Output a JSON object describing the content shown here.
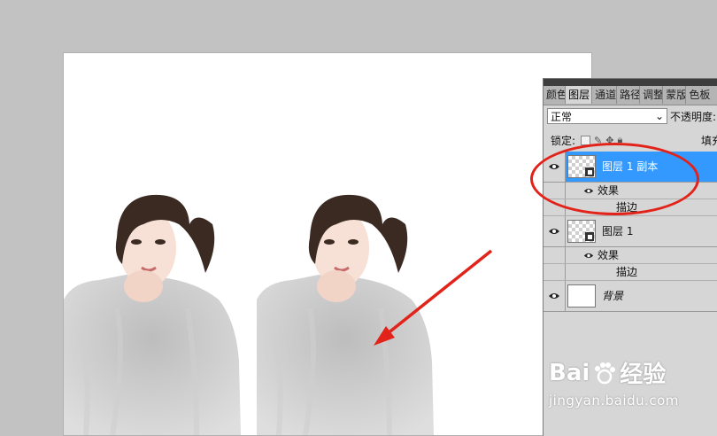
{
  "panel": {
    "tabs": [
      {
        "label": "颜色",
        "active": false
      },
      {
        "label": "图层",
        "active": true
      },
      {
        "label": "通道",
        "active": false
      },
      {
        "label": "路径",
        "active": false
      },
      {
        "label": "调整",
        "active": false
      },
      {
        "label": "蒙版",
        "active": false
      },
      {
        "label": "色板",
        "active": false
      }
    ],
    "blend_mode": "正常",
    "opacity_label": "不透明度:",
    "lock_label": "锁定:",
    "fill_label": "填充:",
    "layers": [
      {
        "name": "图层 1 副本",
        "selected": true,
        "effects_label": "效果",
        "stroke_label": "描边",
        "thumb": "checker-smart"
      },
      {
        "name": "图层 1",
        "selected": false,
        "effects_label": "效果",
        "stroke_label": "描边",
        "thumb": "checker-smart"
      },
      {
        "name": "背景",
        "selected": false,
        "thumb": "white"
      }
    ]
  },
  "watermark": {
    "brand": "Bai",
    "brand2": "经验",
    "url": "jingyan.baidu.com"
  },
  "colors": {
    "highlight": "#3399ff",
    "annotation": "#e2231a",
    "workspace": "#c2c2c2"
  }
}
